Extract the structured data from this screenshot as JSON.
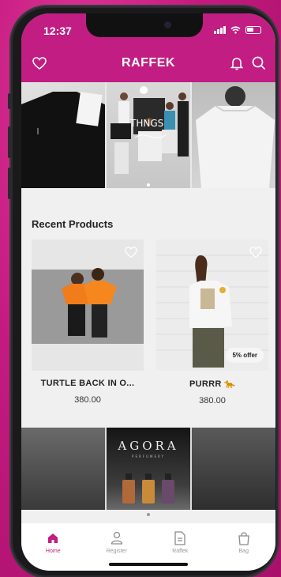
{
  "status": {
    "time": "12:37"
  },
  "header": {
    "brand": "RAFFEK",
    "left_icon": "heart-outline-icon",
    "right_icons": [
      "bell-icon",
      "search-icon"
    ]
  },
  "carousel": {
    "slides": [
      "black-tshirt-back-photo",
      "group-models-thngs-photo",
      "grey-tshirt-back-photo"
    ],
    "overlay_text": "THNGS"
  },
  "recent": {
    "title": "Recent Products",
    "products": [
      {
        "name": "TURTLE BACK IN O...",
        "price": "380.00",
        "badge": ""
      },
      {
        "name": "PURRR 🐆",
        "price": "380.00",
        "badge": "5% offer"
      }
    ]
  },
  "banner": {
    "brand": "AGORA",
    "sub": "PERFUMERY"
  },
  "tabbar": {
    "items": [
      {
        "label": "Home",
        "icon": "home-icon",
        "active": true
      },
      {
        "label": "Register",
        "icon": "user-icon",
        "active": false
      },
      {
        "label": "Raffek",
        "icon": "document-icon",
        "active": false
      },
      {
        "label": "Bag",
        "icon": "bag-icon",
        "active": false
      }
    ]
  },
  "colors": {
    "accent": "#c21d82",
    "background": "#f0f0f0"
  }
}
